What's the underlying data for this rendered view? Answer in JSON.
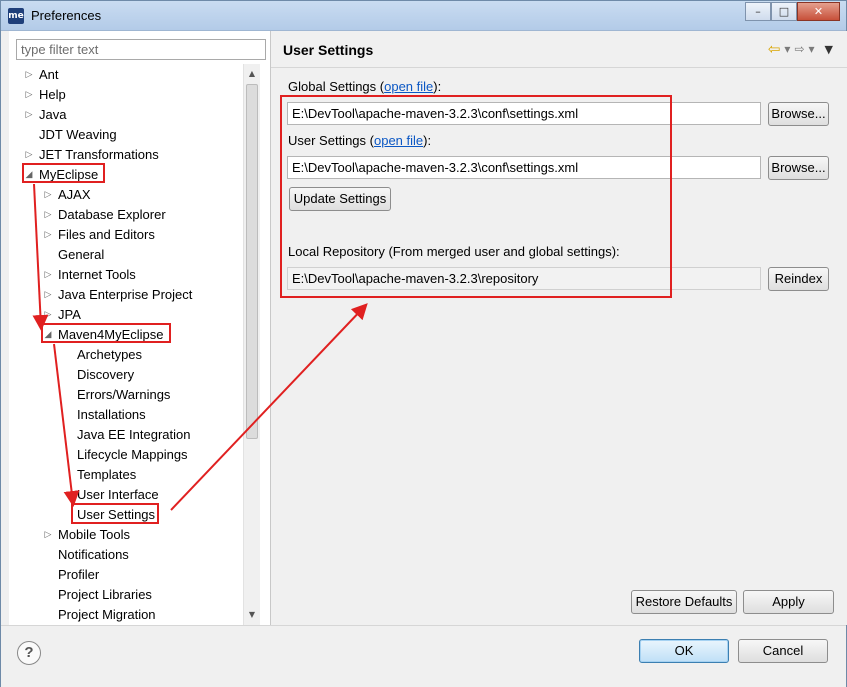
{
  "window": {
    "title": "Preferences",
    "app_icon_text": "me",
    "buttons": {
      "minimize": "–",
      "maximize": "□",
      "close": "✕"
    }
  },
  "filter": {
    "placeholder": "type filter text"
  },
  "tree": {
    "items": [
      {
        "label": "Ant",
        "expander": "collapsed"
      },
      {
        "label": "Help",
        "expander": "collapsed"
      },
      {
        "label": "Java",
        "expander": "collapsed"
      },
      {
        "label": "JDT Weaving",
        "expander": "none"
      },
      {
        "label": "JET Transformations",
        "expander": "collapsed"
      },
      {
        "label": "MyEclipse",
        "expander": "expanded",
        "highlighted": true
      },
      {
        "label": "AJAX",
        "expander": "collapsed"
      },
      {
        "label": "Database Explorer",
        "expander": "collapsed"
      },
      {
        "label": "Files and Editors",
        "expander": "collapsed"
      },
      {
        "label": "General",
        "expander": "none"
      },
      {
        "label": "Internet Tools",
        "expander": "collapsed"
      },
      {
        "label": "Java Enterprise Project",
        "expander": "collapsed"
      },
      {
        "label": "JPA",
        "expander": "collapsed"
      },
      {
        "label": "Maven4MyEclipse",
        "expander": "expanded",
        "highlighted": true
      },
      {
        "label": "Archetypes",
        "expander": "none"
      },
      {
        "label": "Discovery",
        "expander": "none"
      },
      {
        "label": "Errors/Warnings",
        "expander": "none"
      },
      {
        "label": "Installations",
        "expander": "none"
      },
      {
        "label": "Java EE Integration",
        "expander": "none"
      },
      {
        "label": "Lifecycle Mappings",
        "expander": "none"
      },
      {
        "label": "Templates",
        "expander": "none"
      },
      {
        "label": "User Interface",
        "expander": "none"
      },
      {
        "label": "User Settings",
        "expander": "none",
        "selected": true,
        "highlighted": true
      },
      {
        "label": "Mobile Tools",
        "expander": "collapsed"
      },
      {
        "label": "Notifications",
        "expander": "none"
      },
      {
        "label": "Profiler",
        "expander": "none"
      },
      {
        "label": "Project Libraries",
        "expander": "none"
      },
      {
        "label": "Project Migration",
        "expander": "none"
      }
    ]
  },
  "page": {
    "title": "User Settings",
    "nav": {
      "back": "⇦",
      "back_menu": "▾",
      "forward": "⇨",
      "forward_menu": "▾",
      "view_menu": "▼"
    },
    "global_settings": {
      "label": "Global Settings (",
      "link": "open file",
      "label_end": "):",
      "value": "E:\\DevTool\\apache-maven-3.2.3\\conf\\settings.xml",
      "browse": "Browse..."
    },
    "user_settings": {
      "label": "User Settings (",
      "link": "open file",
      "label_end": "):",
      "value": "E:\\DevTool\\apache-maven-3.2.3\\conf\\settings.xml",
      "browse": "Browse..."
    },
    "update_settings": "Update Settings",
    "local_repository": {
      "label": "Local Repository (From merged user and global settings):",
      "value": "E:\\DevTool\\apache-maven-3.2.3\\repository",
      "reindex": "Reindex"
    },
    "restore_defaults": "Restore Defaults",
    "apply": "Apply"
  },
  "footer": {
    "help": "?",
    "ok": "OK",
    "cancel": "Cancel"
  },
  "colors": {
    "highlight": "#e02020",
    "link": "#0b57c4",
    "selection_border": "#e02020"
  }
}
